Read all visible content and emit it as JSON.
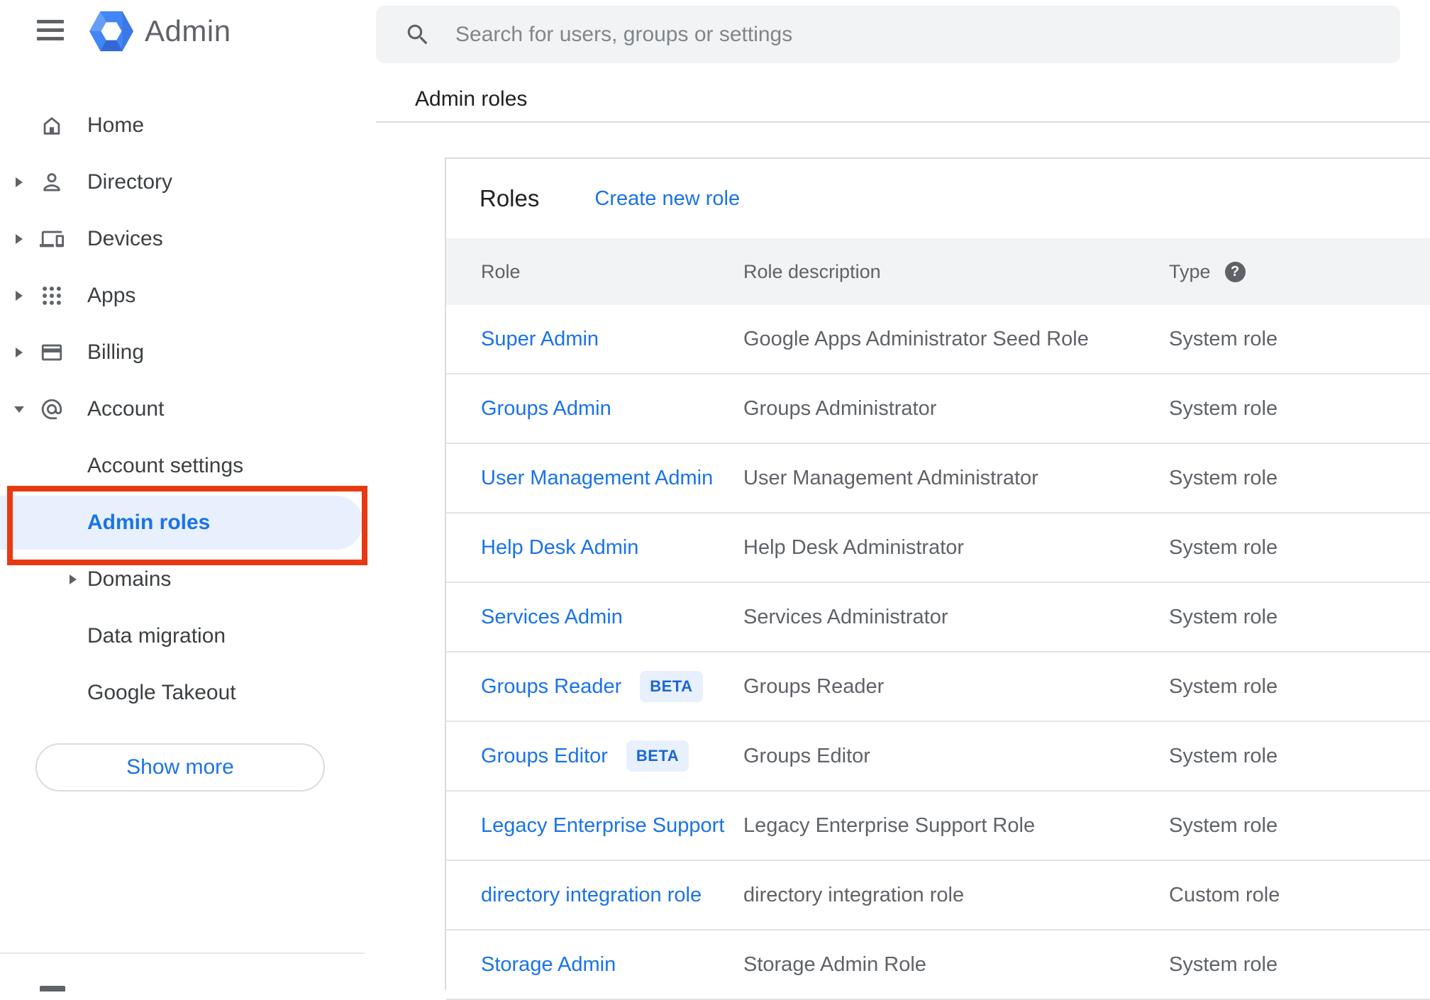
{
  "app": {
    "logo_text": "Admin"
  },
  "search": {
    "placeholder": "Search for users, groups or settings"
  },
  "breadcrumb": "Admin roles",
  "sidebar": {
    "items": [
      {
        "label": "Home",
        "icon": "home-icon",
        "expander": null,
        "indent": false,
        "selected": false
      },
      {
        "label": "Directory",
        "icon": "person-icon",
        "expander": "collapsed",
        "indent": false,
        "selected": false
      },
      {
        "label": "Devices",
        "icon": "devices-icon",
        "expander": "collapsed",
        "indent": false,
        "selected": false
      },
      {
        "label": "Apps",
        "icon": "apps-grid-icon",
        "expander": "collapsed",
        "indent": false,
        "selected": false
      },
      {
        "label": "Billing",
        "icon": "payment-card-icon",
        "expander": "collapsed",
        "indent": false,
        "selected": false
      },
      {
        "label": "Account",
        "icon": "at-sign-icon",
        "expander": "expanded",
        "indent": false,
        "selected": false
      },
      {
        "label": "Account settings",
        "icon": null,
        "expander": null,
        "indent": true,
        "selected": false
      },
      {
        "label": "Admin roles",
        "icon": null,
        "expander": null,
        "indent": true,
        "selected": true,
        "annotated": true
      },
      {
        "label": "Domains",
        "icon": null,
        "expander": "collapsed",
        "indent": true,
        "selected": false
      },
      {
        "label": "Data migration",
        "icon": null,
        "expander": null,
        "indent": true,
        "selected": false
      },
      {
        "label": "Google Takeout",
        "icon": null,
        "expander": null,
        "indent": true,
        "selected": false
      }
    ],
    "show_more_label": "Show more"
  },
  "main": {
    "card_title": "Roles",
    "create_link_label": "Create new role",
    "table": {
      "columns": [
        "Role",
        "Role description",
        "Type"
      ],
      "rows": [
        {
          "role": "Super Admin",
          "beta": false,
          "description": "Google Apps Administrator Seed Role",
          "type": "System role"
        },
        {
          "role": "Groups Admin",
          "beta": false,
          "description": "Groups Administrator",
          "type": "System role"
        },
        {
          "role": "User Management Admin",
          "beta": false,
          "description": "User Management Administrator",
          "type": "System role"
        },
        {
          "role": "Help Desk Admin",
          "beta": false,
          "description": "Help Desk Administrator",
          "type": "System role"
        },
        {
          "role": "Services Admin",
          "beta": false,
          "description": "Services Administrator",
          "type": "System role"
        },
        {
          "role": "Groups Reader",
          "beta": true,
          "description": "Groups Reader",
          "type": "System role"
        },
        {
          "role": "Groups Editor",
          "beta": true,
          "description": "Groups Editor",
          "type": "System role"
        },
        {
          "role": "Legacy Enterprise Support",
          "beta": false,
          "description": "Legacy Enterprise Support Role",
          "type": "System role"
        },
        {
          "role": "directory integration role",
          "beta": false,
          "description": "directory integration role",
          "type": "Custom role"
        },
        {
          "role": "Storage Admin",
          "beta": false,
          "description": "Storage Admin Role",
          "type": "System role"
        }
      ],
      "beta_badge_label": "BETA",
      "help_icon_glyph": "?"
    }
  },
  "colors": {
    "link_blue": "#1a73e8",
    "selected_item_bg": "#e8f0fe",
    "annotation_red": "#e83a12",
    "table_header_bg": "#f1f3f4",
    "searchbar_bg": "#f1f3f4",
    "icon_gray": "#5f6368",
    "text_dark": "#202124",
    "text_gray": "#5f6368",
    "divider": "#dadce0",
    "logo_blue": "#4285f4"
  }
}
